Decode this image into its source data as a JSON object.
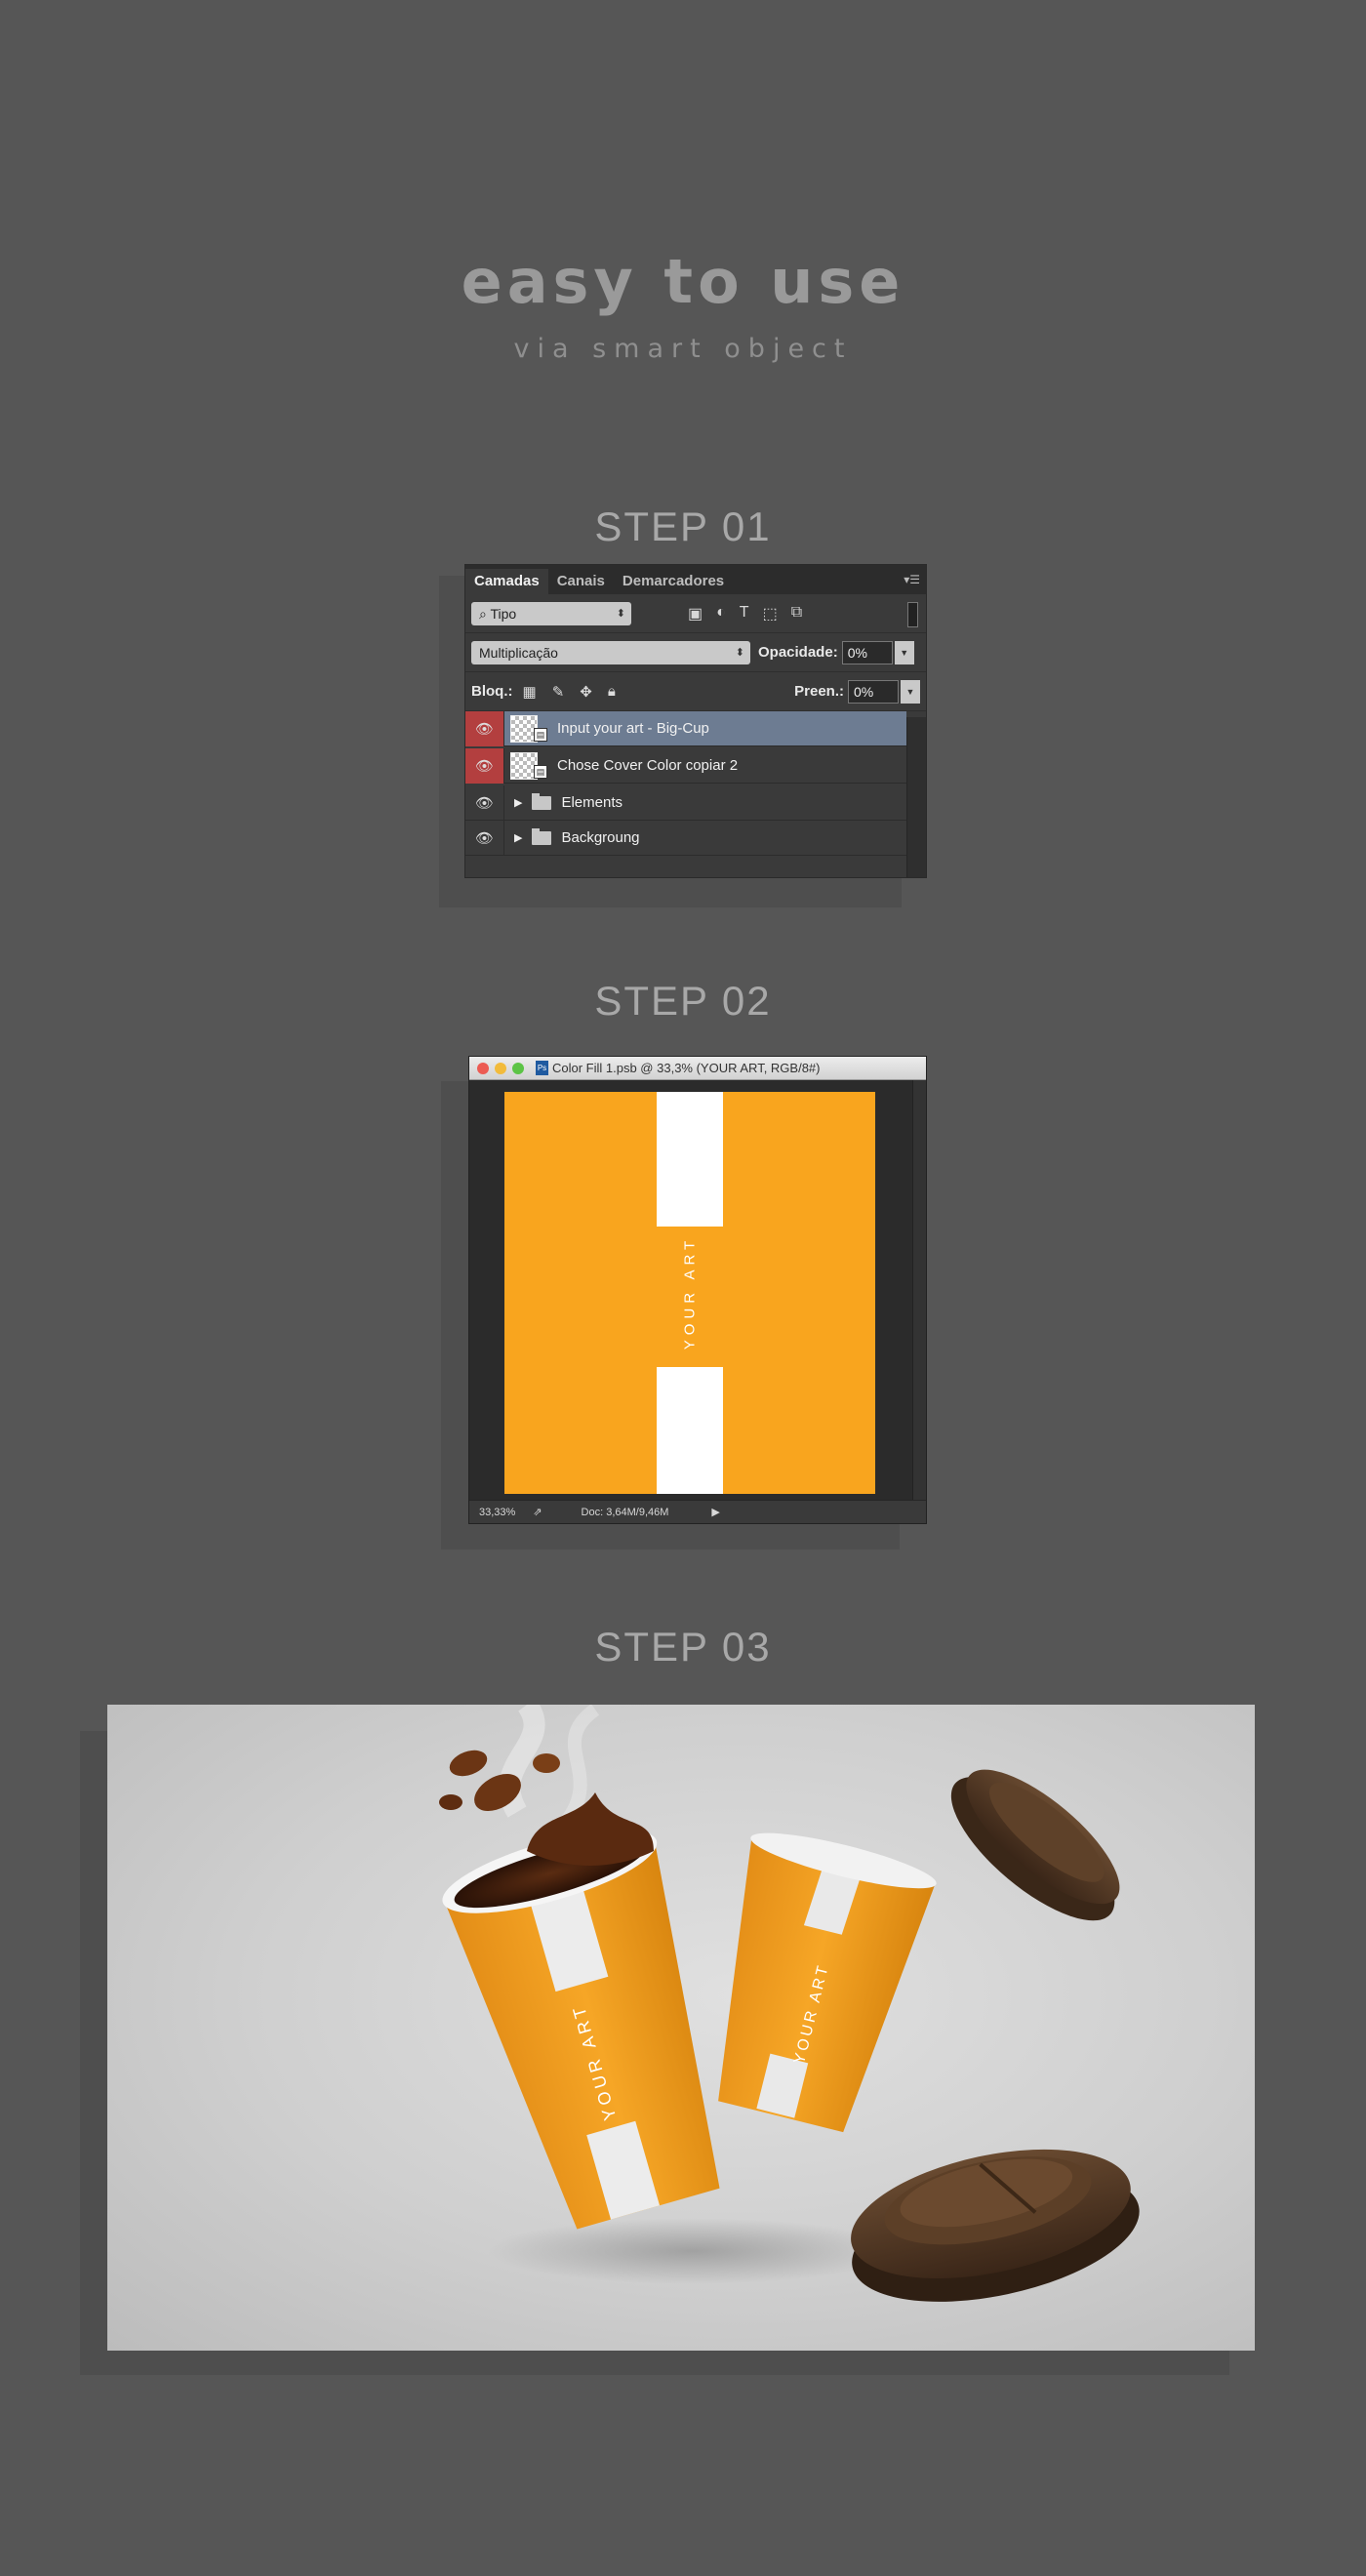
{
  "hero": {
    "title": "easy to use",
    "subtitle": "via smart object"
  },
  "steps": {
    "step1": "STEP 01",
    "step2": "STEP 02",
    "step3": "STEP 03"
  },
  "layers_panel": {
    "tabs": [
      "Camadas",
      "Canais",
      "Demarcadores"
    ],
    "active_tab": "Camadas",
    "filter": {
      "value": "Tipo"
    },
    "blend_mode": "Multiplicação",
    "opacity_label": "Opacidade:",
    "opacity_value": "0%",
    "lock_label": "Bloq.:",
    "fill_label": "Preen.:",
    "fill_value": "0%",
    "layers": [
      {
        "name": "Input your art - Big-Cup",
        "type": "smart-object",
        "selected": true,
        "visible": true,
        "highlight": "#b33f3f"
      },
      {
        "name": "Chose Cover Color copiar 2",
        "type": "smart-object",
        "selected": false,
        "visible": true,
        "highlight": "#b33f3f"
      },
      {
        "name": "Elements",
        "type": "group",
        "selected": false,
        "visible": true
      },
      {
        "name": "Backgroung",
        "type": "group",
        "selected": false,
        "visible": true
      }
    ]
  },
  "document_window": {
    "title": "Color Fill 1.psb @ 33,3% (YOUR ART, RGB/8#)",
    "zoom": "33,33%",
    "doc_info": "Doc: 3,64M/9,46M",
    "art_text": "YOUR ART",
    "art_color": "#f9a51e"
  },
  "mockup": {
    "cup_text_1": "YOUR ART",
    "cup_text_2": "YOUR ART",
    "cup_color": "#f4a422",
    "lid_color": "#4a3423"
  }
}
